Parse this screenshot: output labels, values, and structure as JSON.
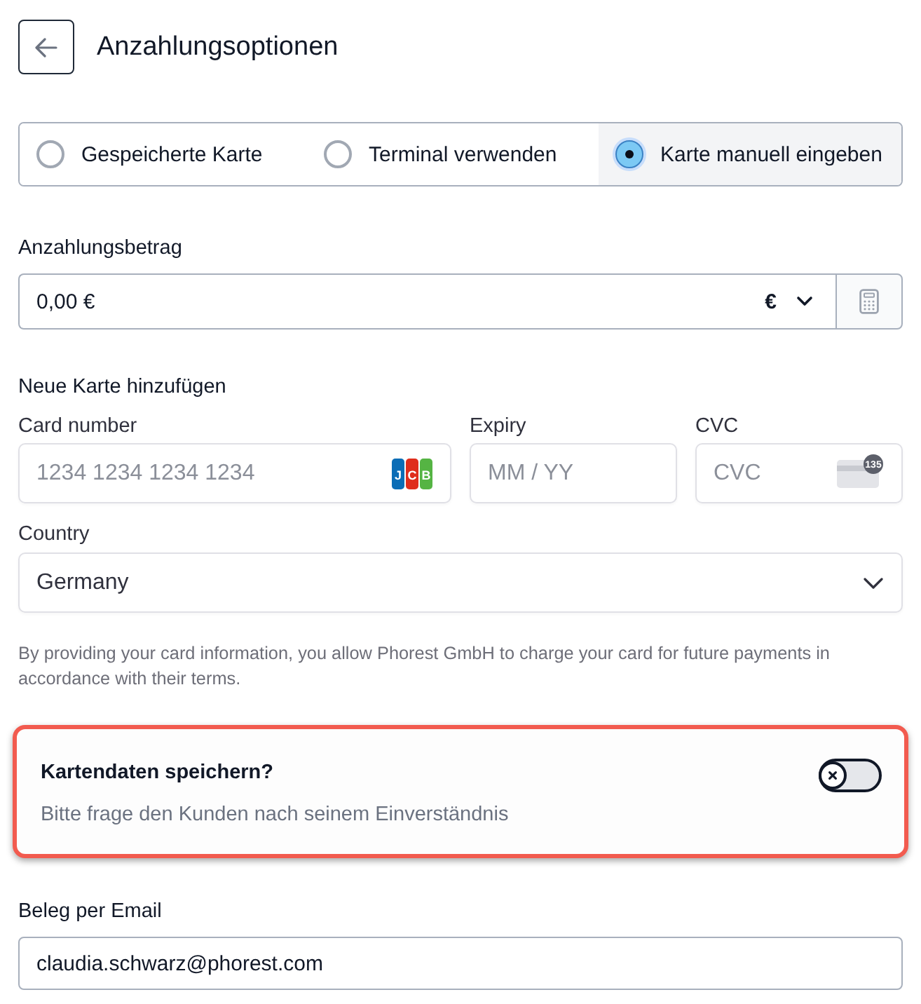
{
  "header": {
    "title": "Anzahlungsoptionen"
  },
  "payment_methods": [
    {
      "label": "Gespeicherte Karte",
      "selected": false
    },
    {
      "label": "Terminal verwenden",
      "selected": false
    },
    {
      "label": "Karte manuell eingeben",
      "selected": true
    }
  ],
  "deposit": {
    "label": "Anzahlungsbetrag",
    "value": "0,00 €",
    "currency": "€"
  },
  "new_card": {
    "heading": "Neue Karte hinzufügen",
    "card_number": {
      "label": "Card number",
      "placeholder": "1234 1234 1234 1234",
      "brand_letters": [
        "J",
        "C",
        "B"
      ]
    },
    "expiry": {
      "label": "Expiry",
      "placeholder": "MM / YY"
    },
    "cvc": {
      "label": "CVC",
      "placeholder": "CVC",
      "icon_badge": "135"
    },
    "country": {
      "label": "Country",
      "value": "Germany"
    },
    "disclaimer": "By providing your card information, you allow Phorest GmbH to charge your card for future payments in accordance with their terms."
  },
  "save_card": {
    "title": "Kartendaten speichern?",
    "subtitle": "Bitte frage den Kunden nach seinem Einverständnis",
    "on": false,
    "highlighted": true
  },
  "receipt_email": {
    "label": "Beleg per Email",
    "value": "claudia.schwarz@phorest.com"
  }
}
